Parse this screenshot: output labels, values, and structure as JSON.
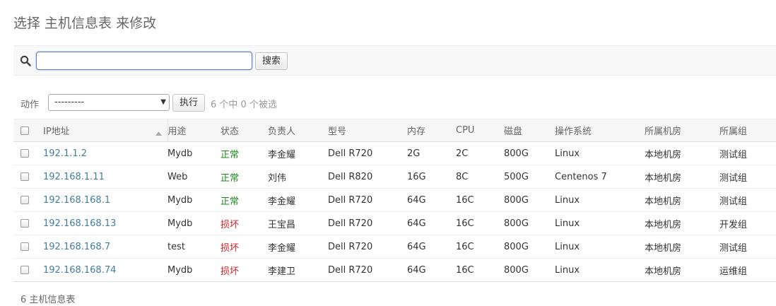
{
  "page": {
    "title": "选择 主机信息表 来修改"
  },
  "search": {
    "value": "",
    "placeholder": "",
    "button_label": "搜索"
  },
  "actions": {
    "label": "动作",
    "selected_option": "---------",
    "run_label": "执行",
    "selection_counter": "6 个中 0 个被选"
  },
  "table": {
    "headers": [
      "IP地址",
      "用途",
      "状态",
      "负责人",
      "型号",
      "内存",
      "CPU",
      "磁盘",
      "操作系统",
      "所属机房",
      "所属组"
    ],
    "rows": [
      {
        "ip": "192.1.1.2",
        "usage": "Mydb",
        "status": "正常",
        "owner": "李金耀",
        "model": "Dell R720",
        "memory": "2G",
        "cpu": "2C",
        "disk": "800G",
        "os": "Linux",
        "room": "本地机房",
        "group": "测试组"
      },
      {
        "ip": "192.168.1.11",
        "usage": "Web",
        "status": "正常",
        "owner": "刘伟",
        "model": "Dell R820",
        "memory": "16G",
        "cpu": "8C",
        "disk": "500G",
        "os": "Centenos 7",
        "room": "本地机房",
        "group": "测试组"
      },
      {
        "ip": "192.168.168.1",
        "usage": "Mydb",
        "status": "正常",
        "owner": "李金耀",
        "model": "Dell R720",
        "memory": "64G",
        "cpu": "16C",
        "disk": "800G",
        "os": "Linux",
        "room": "本地机房",
        "group": "测试组"
      },
      {
        "ip": "192.168.168.13",
        "usage": "Mydb",
        "status": "损坏",
        "owner": "王宝昌",
        "model": "Dell R720",
        "memory": "64G",
        "cpu": "16C",
        "disk": "800G",
        "os": "Linux",
        "room": "本地机房",
        "group": "开发组"
      },
      {
        "ip": "192.168.168.7",
        "usage": "test",
        "status": "损坏",
        "owner": "李金耀",
        "model": "Dell R720",
        "memory": "64G",
        "cpu": "16C",
        "disk": "800G",
        "os": "Linux",
        "room": "本地机房",
        "group": "测试组"
      },
      {
        "ip": "192.168.168.74",
        "usage": "Mydb",
        "status": "损坏",
        "owner": "李建卫",
        "model": "Dell R720",
        "memory": "64G",
        "cpu": "16C",
        "disk": "800G",
        "os": "Linux",
        "room": "本地机房",
        "group": "运维组"
      }
    ]
  },
  "footer": {
    "count_text": "6 主机信息表"
  },
  "colors": {
    "link": "#447e9b",
    "status_ok": "#1e8a1e",
    "status_bad": "#cc2222",
    "focus_border": "#5b80b2"
  },
  "icons": {
    "search": "search-icon",
    "sort": "sort-asc-icon",
    "dropdown": "chevron-down-icon"
  }
}
